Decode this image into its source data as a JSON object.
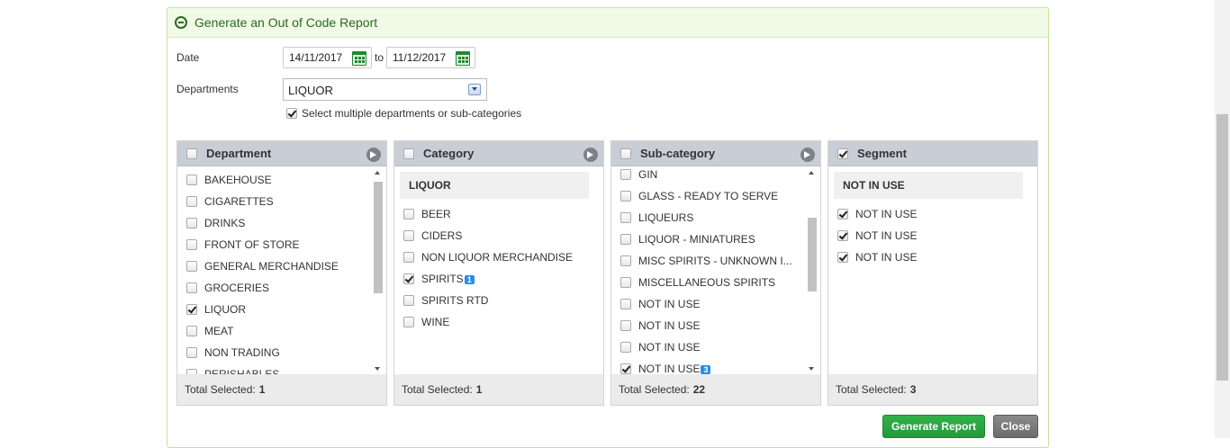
{
  "panel": {
    "title": "Generate an Out of Code Report"
  },
  "form": {
    "date_label": "Date",
    "date_from": "14/11/2017",
    "date_to_label": "to",
    "date_to": "11/12/2017",
    "departments_label": "Departments",
    "departments_value": "LIQUOR",
    "multi_select_label": "Select multiple departments or sub-categories",
    "multi_select_checked": true
  },
  "department": {
    "title": "Department",
    "items": [
      {
        "label": "BAKEHOUSE",
        "checked": false
      },
      {
        "label": "CIGARETTES",
        "checked": false
      },
      {
        "label": "DRINKS",
        "checked": false
      },
      {
        "label": "FRONT OF STORE",
        "checked": false
      },
      {
        "label": "GENERAL MERCHANDISE",
        "checked": false
      },
      {
        "label": "GROCERIES",
        "checked": false
      },
      {
        "label": "LIQUOR",
        "checked": true
      },
      {
        "label": "MEAT",
        "checked": false
      },
      {
        "label": "NON TRADING",
        "checked": false
      },
      {
        "label": "PERISHABLES",
        "checked": false
      }
    ],
    "total_label": "Total Selected:",
    "total": "1"
  },
  "category": {
    "title": "Category",
    "group": "LIQUOR",
    "items": [
      {
        "label": "BEER",
        "checked": false
      },
      {
        "label": "CIDERS",
        "checked": false
      },
      {
        "label": "NON LIQUOR MERCHANDISE",
        "checked": false
      },
      {
        "label": "SPIRITS",
        "checked": true,
        "badge": "1"
      },
      {
        "label": "SPIRITS RTD",
        "checked": false
      },
      {
        "label": "WINE",
        "checked": false
      }
    ],
    "total_label": "Total Selected:",
    "total": "1"
  },
  "subcategory": {
    "title": "Sub-category",
    "items": [
      {
        "label": "GIN",
        "checked": false
      },
      {
        "label": "GLASS - READY TO SERVE",
        "checked": false
      },
      {
        "label": "LIQUEURS",
        "checked": false
      },
      {
        "label": "LIQUOR - MINIATURES",
        "checked": false
      },
      {
        "label": "MISC SPIRITS - UNKNOWN I...",
        "checked": false
      },
      {
        "label": "MISCELLANEOUS SPIRITS",
        "checked": false
      },
      {
        "label": "NOT IN USE",
        "checked": false
      },
      {
        "label": "NOT IN USE",
        "checked": false
      },
      {
        "label": "NOT IN USE",
        "checked": false
      },
      {
        "label": "NOT IN USE",
        "checked": true,
        "badge": "3"
      }
    ],
    "total_label": "Total Selected:",
    "total": "22"
  },
  "segment": {
    "title": "Segment",
    "header_checked": true,
    "group": "NOT IN USE",
    "items": [
      {
        "label": "NOT IN USE",
        "checked": true
      },
      {
        "label": "NOT IN USE",
        "checked": true
      },
      {
        "label": "NOT IN USE",
        "checked": true
      }
    ],
    "total_label": "Total Selected:",
    "total": "3"
  },
  "buttons": {
    "generate": "Generate Report",
    "close": "Close"
  }
}
